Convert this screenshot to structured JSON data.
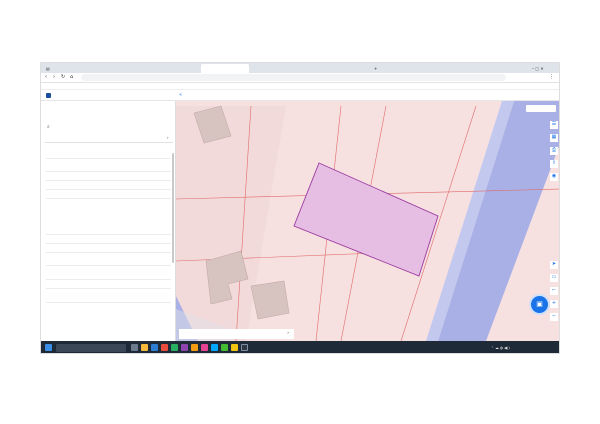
{
  "browser": {
    "tabs": [
      {
        "label": "",
        "active": false
      },
      {
        "label": "",
        "active": false
      },
      {
        "label": "",
        "active": false
      },
      {
        "label": "",
        "active": true
      },
      {
        "label": "",
        "active": false
      },
      {
        "label": "",
        "active": false
      }
    ],
    "window_title": "",
    "address": "",
    "profile": "",
    "bookmarks": [
      ""
    ],
    "other_bookmarks": ""
  },
  "site": {
    "logo_text": ""
  },
  "panel": {
    "back_link": "",
    "title": "",
    "tabs": [
      "",
      "",
      "",
      "",
      ""
    ],
    "rows": [
      {
        "key": "",
        "value": ""
      },
      {
        "key": "",
        "value": ""
      },
      {
        "key": "",
        "value": ""
      },
      {
        "key": "",
        "value": ""
      },
      {
        "key": "",
        "value": ""
      },
      {
        "key": "",
        "value": ""
      },
      {
        "key": "",
        "value": ""
      },
      {
        "key": "",
        "value": ""
      },
      {
        "key": "",
        "value": ""
      },
      {
        "key": "",
        "value": ""
      },
      {
        "key": "",
        "value": ""
      },
      {
        "key": "",
        "value": ""
      },
      {
        "key": "",
        "value": ""
      }
    ],
    "address_link": ""
  },
  "map": {
    "filter_label": "",
    "bottom_label": "",
    "attribution": "",
    "scale": "",
    "colors": {
      "parcel_fill": "#e6bde3",
      "parcel_stroke": "#9a3ca0",
      "road": "#a8b0e6",
      "building": "#d7c4c0",
      "boundary": "#e06a6a"
    }
  },
  "taskbar": {
    "search_placeholder": "",
    "language": "",
    "time": "",
    "date": ""
  }
}
